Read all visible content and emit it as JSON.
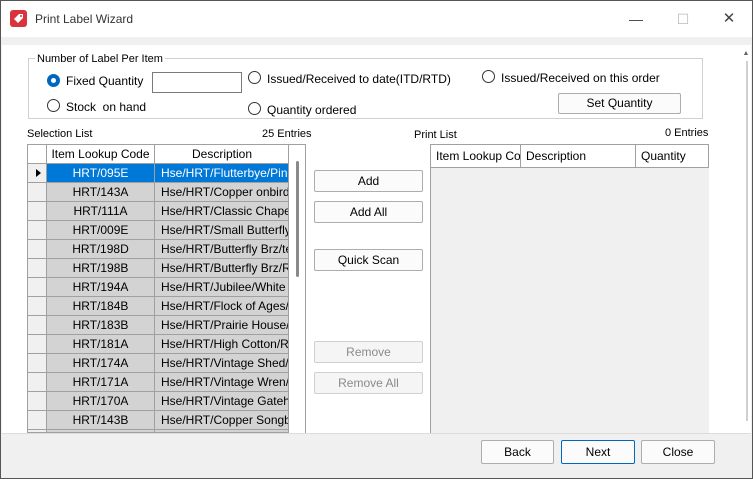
{
  "window": {
    "title": "Print Label Wizard",
    "minimize": "—",
    "maximize": "☐",
    "close": "✕"
  },
  "label_group": {
    "title": "Number of Label Per Item",
    "options": [
      {
        "label": "Fixed Quantity",
        "checked": true
      },
      {
        "label": "Stock  on hand",
        "checked": false
      },
      {
        "label": "Issued/Received to date(ITD/RTD)",
        "checked": false
      },
      {
        "label": "Quantity ordered",
        "checked": false
      },
      {
        "label": "Issued/Received on this order",
        "checked": false
      }
    ],
    "fixed_quantity_value": "",
    "set_quantity_label": "Set Quantity"
  },
  "selection_list": {
    "title": "Selection List",
    "entries": "25 Entries",
    "columns": [
      "Item Lookup Code",
      "Description"
    ],
    "rows": [
      {
        "code": "HRT/095E",
        "desc": "Hse/HRT/Flutterbye/Pini",
        "selected": true
      },
      {
        "code": "HRT/143A",
        "desc": "Hse/HRT/Copper onbird/"
      },
      {
        "code": "HRT/111A",
        "desc": "Hse/HRT/Classic Chape"
      },
      {
        "code": "HRT/009E",
        "desc": "Hse/HRT/Small Butterfly"
      },
      {
        "code": "HRT/198D",
        "desc": "Hse/HRT/Butterfly Brz/te"
      },
      {
        "code": "HRT/198B",
        "desc": "Hse/HRT/Butterfly Brz/R"
      },
      {
        "code": "HRT/194A",
        "desc": "Hse/HRT/Jubilee/White"
      },
      {
        "code": "HRT/184B",
        "desc": "Hse/HRT/Flock of Ages/"
      },
      {
        "code": "HRT/183B",
        "desc": "Hse/HRT/Prairie House/"
      },
      {
        "code": "HRT/181A",
        "desc": "Hse/HRT/High Cotton/R"
      },
      {
        "code": "HRT/174A",
        "desc": "Hse/HRT/Vintage Shed/"
      },
      {
        "code": "HRT/171A",
        "desc": "Hse/HRT/Vintage Wren/"
      },
      {
        "code": "HRT/170A",
        "desc": "Hse/HRT/Vintage Gateh"
      },
      {
        "code": "HRT/143B",
        "desc": "Hse/HRT/Copper Songbi"
      },
      {
        "code": "",
        "desc": ""
      }
    ]
  },
  "actions": {
    "add": "Add",
    "add_all": "Add All",
    "quick_scan": "Quick Scan",
    "remove": "Remove",
    "remove_all": "Remove All"
  },
  "print_list": {
    "title": "Print List",
    "entries": "0 Entries",
    "columns": [
      "Item Lookup Co",
      "Description",
      "Quantity"
    ]
  },
  "footer": {
    "back": "Back",
    "next": "Next",
    "close": "Close"
  },
  "colors": {
    "accent": "#0078d7",
    "row_background": "#d3d3d3",
    "app_icon": "#d9343b"
  }
}
